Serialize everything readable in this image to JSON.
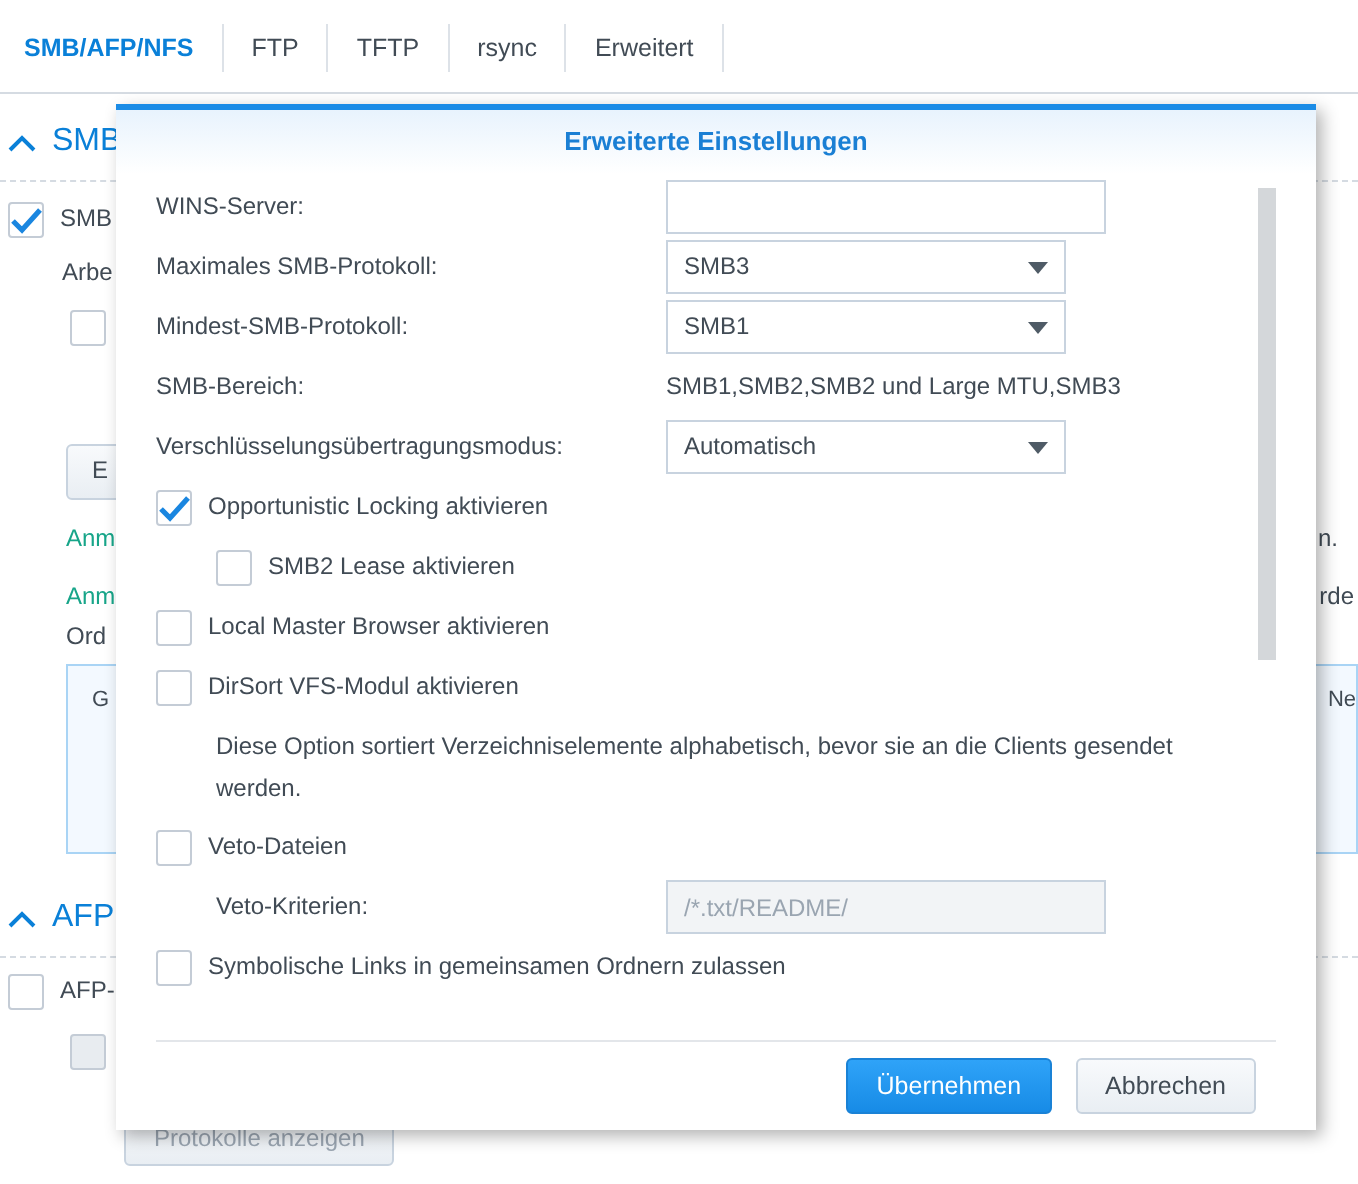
{
  "tabs": [
    {
      "label": "SMB/AFP/NFS",
      "selected": true
    },
    {
      "label": "FTP",
      "selected": false
    },
    {
      "label": "TFTP",
      "selected": false
    },
    {
      "label": "rsync",
      "selected": false
    },
    {
      "label": "Erweitert",
      "selected": false
    }
  ],
  "smb_section": {
    "title": "SMB",
    "expanded": true,
    "enable_checkbox": {
      "label": "SMB",
      "checked": true
    },
    "text": "Arbe",
    "checkbox": {
      "checked": false,
      "disabled": false
    },
    "button": "E",
    "note_1": {
      "left": "Anm",
      "right": "n."
    },
    "note_2": {
      "left": "Anm",
      "right": "rde",
      "line_2": "Ord"
    },
    "info_panel": {
      "left": "G",
      "right": "Ne"
    }
  },
  "afp_section": {
    "title": "AFP",
    "expanded": true,
    "enable_checkbox": {
      "label": "AFP-",
      "checked": false
    },
    "checkbox": {
      "checked": false,
      "disabled": true
    },
    "button": "Protokolle anzeigen"
  },
  "dialog": {
    "title": "Erweiterte Einstellungen",
    "rows": [
      {
        "kind": "field",
        "label": "WINS-Server:",
        "disabled": false
      },
      {
        "kind": "select",
        "label": "Maximales SMB-Protokoll:",
        "value": "SMB3"
      },
      {
        "kind": "select",
        "label": "Mindest-SMB-Protokoll:",
        "value": "SMB1"
      },
      {
        "kind": "text",
        "label": "SMB-Bereich:",
        "value": "SMB1,SMB2,SMB2 und Large MTU,SMB3"
      },
      {
        "kind": "select",
        "label": "Verschlüsselungsübertragungsmodus:",
        "value": "Automatisch"
      },
      {
        "kind": "checkbox",
        "label": "Opportunistic Locking aktivieren",
        "checked": true,
        "children": [
          {
            "kind": "checkbox",
            "label": "SMB2 Lease aktivieren",
            "checked": false
          }
        ]
      },
      {
        "kind": "checkbox",
        "label": "Local Master Browser aktivieren",
        "checked": false
      },
      {
        "kind": "checkbox",
        "label": "DirSort VFS-Modul aktivieren",
        "checked": false,
        "children": [
          {
            "kind": "note",
            "text": "Diese Option sortiert Verzeichniselemente alphabetisch, bevor sie an die Clients gesendet werden."
          }
        ]
      },
      {
        "kind": "checkbox",
        "label": "Veto-Dateien",
        "checked": false,
        "children": [
          {
            "kind": "field",
            "label": "Veto-Kriterien:",
            "placeholder": "/*.txt/README/",
            "disabled": true
          }
        ]
      },
      {
        "kind": "checkbox",
        "label": "Symbolische Links in gemeinsamen Ordnern zulassen",
        "checked": false
      }
    ],
    "buttons": [
      {
        "label": "Übernehmen",
        "primary": true
      },
      {
        "label": "Abbrechen",
        "primary": false
      }
    ]
  }
}
